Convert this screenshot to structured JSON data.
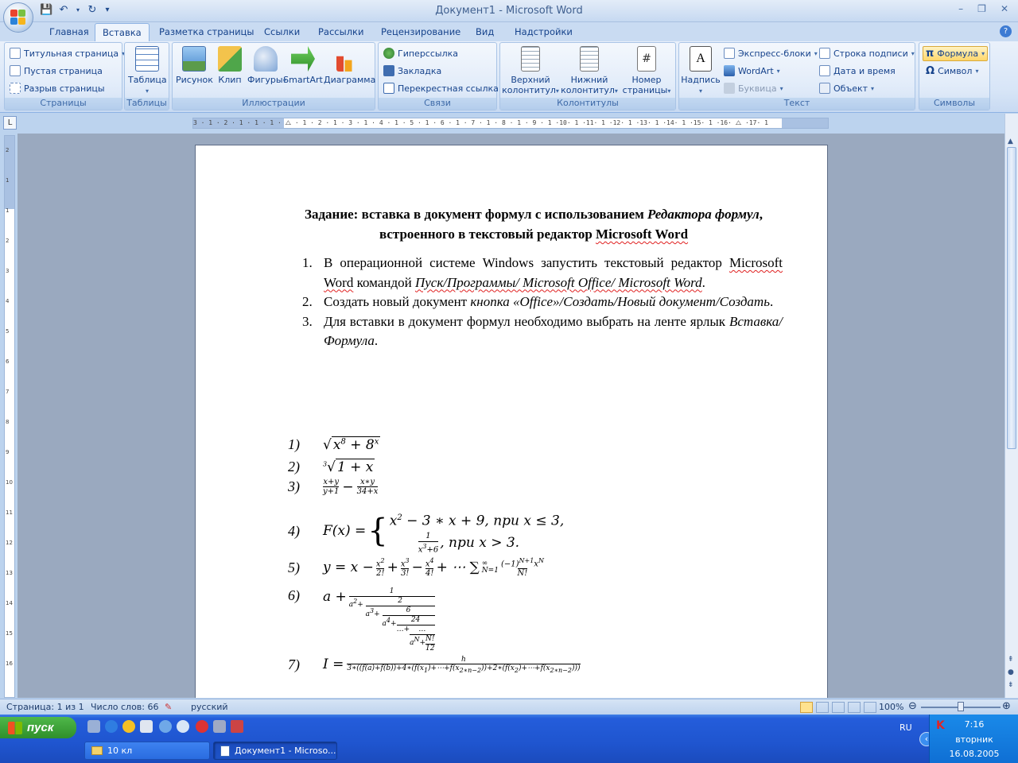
{
  "window": {
    "title": "Документ1 - Microsoft Word",
    "controls": [
      "–",
      "❐",
      "✕"
    ]
  },
  "ribbon_tabs": [
    "Главная",
    "Вставка",
    "Разметка страницы",
    "Ссылки",
    "Рассылки",
    "Рецензирование",
    "Вид",
    "Надстройки"
  ],
  "ribbon": {
    "pages": {
      "label": "Страницы",
      "items": [
        "Титульная страница",
        "Пустая страница",
        "Разрыв страницы"
      ]
    },
    "tables": {
      "label": "Таблицы",
      "button": "Таблица"
    },
    "illustrations": {
      "label": "Иллюстрации",
      "buttons": [
        "Рисунок",
        "Клип",
        "Фигуры",
        "SmartArt",
        "Диаграмма"
      ]
    },
    "links": {
      "label": "Связи",
      "items": [
        "Гиперссылка",
        "Закладка",
        "Перекрестная ссылка"
      ]
    },
    "header_footer": {
      "label": "Колонтитулы",
      "buttons": [
        [
          "Верхний",
          "колонтитул"
        ],
        [
          "Нижний",
          "колонтитул"
        ],
        [
          "Номер",
          "страницы"
        ]
      ]
    },
    "text": {
      "label": "Текст",
      "big": "Надпись",
      "col1": [
        "Экспресс-блоки",
        "WordArt",
        "Буквица"
      ],
      "col2": [
        "Строка подписи",
        "Дата и время",
        "Объект"
      ]
    },
    "symbols": {
      "label": "Символы",
      "items": [
        "Формула",
        "Символ"
      ]
    }
  },
  "ruler": {
    "h_ticks": "3 · 1 · 2 · 1 · 1 · 1 · ⧍ · 1 · 2 · 1 · 3 · 1 · 4 · 1 · 5 · 1 · 6 · 1 · 7 · 1 · 8 · 1 · 9 · 1 ·10· 1 ·11· 1 ·12· 1 ·13· 1 ·14· 1 ·15· 1 ·16· ⧍ ·17· 1",
    "v_ticks": [
      "2",
      "1",
      "1",
      "2",
      "3",
      "4",
      "5",
      "6",
      "7",
      "8",
      "9",
      "10",
      "11",
      "12",
      "13",
      "14",
      "15",
      "16"
    ]
  },
  "document": {
    "heading_parts": {
      "a": "Задание: вставка в документ формул с использованием ",
      "b": "Редактора формул",
      "c": ", встроенного в текстовый редактор ",
      "d": "Microsoft Word"
    },
    "list": [
      {
        "num": "1.",
        "a": "В операционной системе Windows запустить текстовый редактор ",
        "b": "Microsoft",
        "c": " ",
        "d": "Word",
        "e": " командой ",
        "f": "Пуск/Программы/ Microsoft Office/ Microsoft Word",
        "g": "."
      },
      {
        "num": "2.",
        "a": "Создать новый документ ",
        "f": "кнопка «Office»/Создать/Новый документ/Создать",
        "g": "."
      },
      {
        "num": "3.",
        "a": "Для вставки в документ формул необходимо выбрать на ленте ярлык ",
        "f": "Вставка/Формула",
        "g": "."
      }
    ],
    "formula_numbers": [
      "1)",
      "2)",
      "3)",
      "4)",
      "5)",
      "6)",
      "7)"
    ]
  },
  "statusbar": {
    "page": "Страница: 1 из 1",
    "words": "Число слов: 66",
    "lang": "русский",
    "zoom": "100%",
    "zoom_percent": 100
  },
  "taskbar": {
    "start": "пуск",
    "tasks": [
      "10 кл",
      "Документ1 - Microso..."
    ],
    "lang": "RU",
    "time": "7:16",
    "day": "вторник",
    "date": "16.08.2005"
  },
  "colors": {
    "ribbon_bg": "#d7e5f7",
    "accent": "#15428b",
    "taskbar": "#245ddb",
    "start": "#3a9a35"
  }
}
